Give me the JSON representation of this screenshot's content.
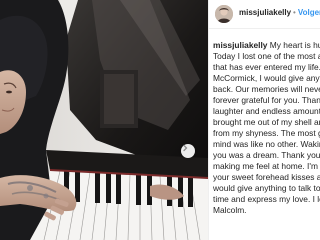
{
  "post": {
    "author": "missjuliakelly",
    "separator": "•",
    "follow_label": "Volgen",
    "caption_username": "missjuliakelly",
    "caption_lines": [
      " My heart is hurting.",
      "Today I lost one of the most ama",
      "that has ever entered my life. Ma",
      "McCormick, I would give anything",
      "back. Our memories will never be",
      "forever grateful for you. Thank yo",
      "laughter and endless amounts of",
      "brought me out of my shell and b",
      "from my shyness. The most gentl",
      "mind was like no other. Waking u",
      "you was a dream. Thank you for a",
      "making me feel at home. I'm goi",
      "your sweet forehead kisses and a",
      "would give anything to talk to yo",
      "time and express my love. I love y",
      "Malcolm."
    ]
  },
  "photo": {
    "subject": "person in black hoodie playing piano",
    "nav_icon": "chevron-right-icon"
  }
}
